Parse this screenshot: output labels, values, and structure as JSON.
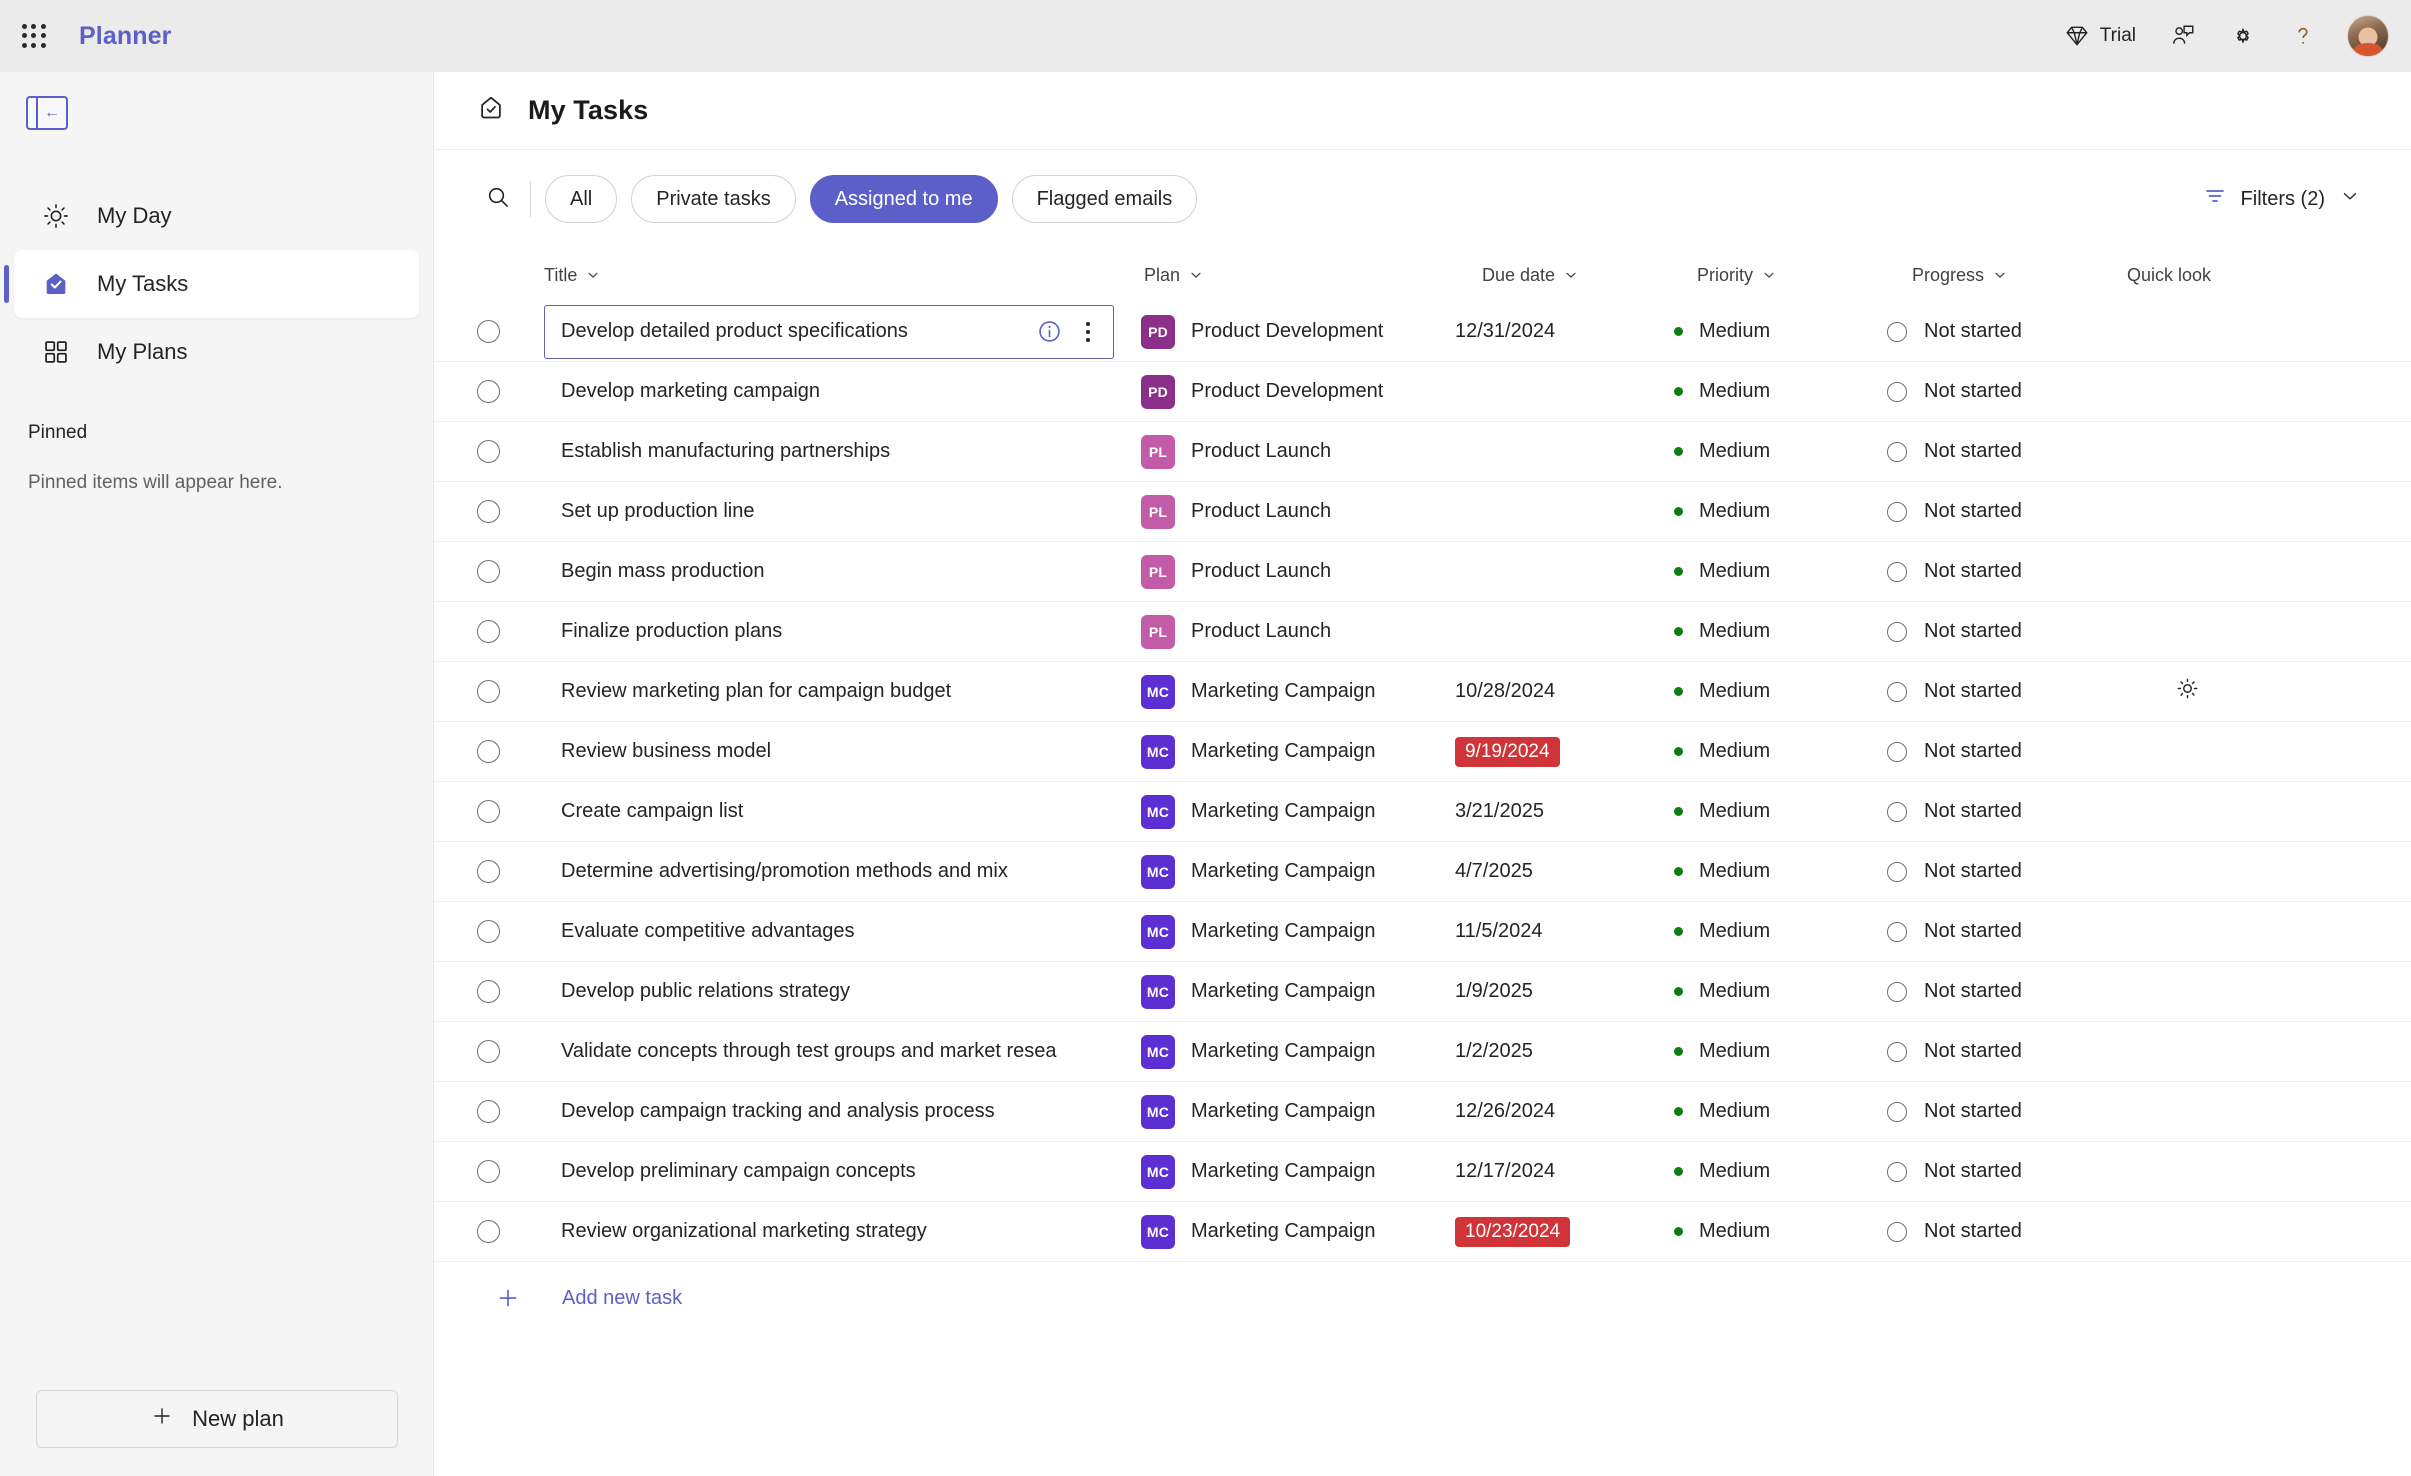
{
  "topbar": {
    "app_title": "Planner",
    "waffle_icon": "app-launcher-icon",
    "trial_label": "Trial",
    "trial_icon": "diamond-icon",
    "feedback_icon": "feedback-person-icon",
    "settings_icon": "gear-icon",
    "help_icon": "question-mark-icon",
    "avatar_icon": "user-avatar"
  },
  "sidebar": {
    "collapse_icon": "collapse-panel-icon",
    "items": [
      {
        "label": "My Day",
        "icon": "sun-icon",
        "active": false
      },
      {
        "label": "My Tasks",
        "icon": "tasks-checkmark-icon",
        "active": true
      },
      {
        "label": "My Plans",
        "icon": "grid-squares-icon",
        "active": false
      }
    ],
    "pinned_heading": "Pinned",
    "pinned_empty_text": "Pinned items will appear here.",
    "new_plan_label": "New plan",
    "new_plan_icon": "plus-icon"
  },
  "page": {
    "title": "My Tasks",
    "title_icon": "tasks-checkmark-outline-icon"
  },
  "toolbar": {
    "search_icon": "search-icon",
    "pills": [
      {
        "label": "All",
        "active": false
      },
      {
        "label": "Private tasks",
        "active": false
      },
      {
        "label": "Assigned to me",
        "active": true
      },
      {
        "label": "Flagged emails",
        "active": false
      }
    ],
    "filters_label": "Filters (2)",
    "filters_icon": "filter-icon",
    "filters_chevron": "chevron-down-icon",
    "accent_color": "#5b5fc7"
  },
  "table": {
    "columns": [
      {
        "label": "Title",
        "sortable": true
      },
      {
        "label": "Plan",
        "sortable": true
      },
      {
        "label": "Due date",
        "sortable": true
      },
      {
        "label": "Priority",
        "sortable": true
      },
      {
        "label": "Progress",
        "sortable": true
      },
      {
        "label": "Quick look",
        "sortable": false
      }
    ],
    "plan_colors": {
      "Product Development": "#8b2f8b",
      "Product Launch": "#c25ba8",
      "Marketing Campaign": "#5b2fd1"
    },
    "priority_dot_color": "#107c10",
    "overdue_color": "#d13438",
    "rows": [
      {
        "title": "Develop detailed product specifications",
        "plan": "Product Development",
        "plan_initials": "PD",
        "due": "12/31/2024",
        "overdue": false,
        "priority": "Medium",
        "progress": "Not started",
        "focused": true,
        "hovered": false
      },
      {
        "title": "Develop marketing campaign",
        "plan": "Product Development",
        "plan_initials": "PD",
        "due": "",
        "overdue": false,
        "priority": "Medium",
        "progress": "Not started",
        "focused": false,
        "hovered": false
      },
      {
        "title": "Establish manufacturing partnerships",
        "plan": "Product Launch",
        "plan_initials": "PL",
        "due": "",
        "overdue": false,
        "priority": "Medium",
        "progress": "Not started",
        "focused": false,
        "hovered": false
      },
      {
        "title": "Set up production line",
        "plan": "Product Launch",
        "plan_initials": "PL",
        "due": "",
        "overdue": false,
        "priority": "Medium",
        "progress": "Not started",
        "focused": false,
        "hovered": false
      },
      {
        "title": "Begin mass production",
        "plan": "Product Launch",
        "plan_initials": "PL",
        "due": "",
        "overdue": false,
        "priority": "Medium",
        "progress": "Not started",
        "focused": false,
        "hovered": false
      },
      {
        "title": "Finalize production plans",
        "plan": "Product Launch",
        "plan_initials": "PL",
        "due": "",
        "overdue": false,
        "priority": "Medium",
        "progress": "Not started",
        "focused": false,
        "hovered": false
      },
      {
        "title": "Review marketing plan for campaign budget",
        "plan": "Marketing Campaign",
        "plan_initials": "MC",
        "due": "10/28/2024",
        "overdue": false,
        "priority": "Medium",
        "progress": "Not started",
        "focused": false,
        "hovered": true
      },
      {
        "title": "Review business model",
        "plan": "Marketing Campaign",
        "plan_initials": "MC",
        "due": "9/19/2024",
        "overdue": true,
        "priority": "Medium",
        "progress": "Not started",
        "focused": false,
        "hovered": false
      },
      {
        "title": "Create campaign list",
        "plan": "Marketing Campaign",
        "plan_initials": "MC",
        "due": "3/21/2025",
        "overdue": false,
        "priority": "Medium",
        "progress": "Not started",
        "focused": false,
        "hovered": false
      },
      {
        "title": "Determine advertising/promotion methods and mix",
        "plan": "Marketing Campaign",
        "plan_initials": "MC",
        "due": "4/7/2025",
        "overdue": false,
        "priority": "Medium",
        "progress": "Not started",
        "focused": false,
        "hovered": false
      },
      {
        "title": "Evaluate competitive advantages",
        "plan": "Marketing Campaign",
        "plan_initials": "MC",
        "due": "11/5/2024",
        "overdue": false,
        "priority": "Medium",
        "progress": "Not started",
        "focused": false,
        "hovered": false
      },
      {
        "title": "Develop public relations strategy",
        "plan": "Marketing Campaign",
        "plan_initials": "MC",
        "due": "1/9/2025",
        "overdue": false,
        "priority": "Medium",
        "progress": "Not started",
        "focused": false,
        "hovered": false
      },
      {
        "title": "Validate concepts through test groups and market resea",
        "plan": "Marketing Campaign",
        "plan_initials": "MC",
        "due": "1/2/2025",
        "overdue": false,
        "priority": "Medium",
        "progress": "Not started",
        "focused": false,
        "hovered": false
      },
      {
        "title": "Develop campaign tracking and analysis process",
        "plan": "Marketing Campaign",
        "plan_initials": "MC",
        "due": "12/26/2024",
        "overdue": false,
        "priority": "Medium",
        "progress": "Not started",
        "focused": false,
        "hovered": false
      },
      {
        "title": "Develop preliminary campaign concepts",
        "plan": "Marketing Campaign",
        "plan_initials": "MC",
        "due": "12/17/2024",
        "overdue": false,
        "priority": "Medium",
        "progress": "Not started",
        "focused": false,
        "hovered": false
      },
      {
        "title": "Review organizational marketing strategy",
        "plan": "Marketing Campaign",
        "plan_initials": "MC",
        "due": "10/23/2024",
        "overdue": true,
        "priority": "Medium",
        "progress": "Not started",
        "focused": false,
        "hovered": false
      }
    ],
    "add_task_label": "Add new task",
    "add_task_icon": "plus-icon"
  }
}
